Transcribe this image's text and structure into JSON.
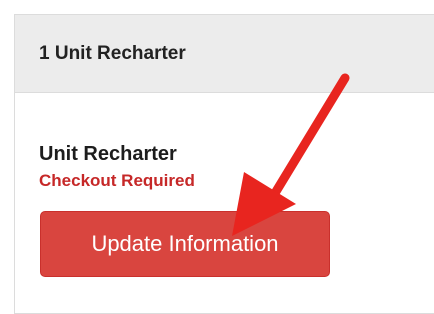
{
  "panel": {
    "title": "1 Unit Recharter"
  },
  "item": {
    "name": "Unit Recharter",
    "status": "Checkout Required",
    "button_label": "Update Information"
  },
  "annotation": {
    "arrow_color": "#e8251f",
    "arrow_icon": "red-arrow-icon"
  }
}
